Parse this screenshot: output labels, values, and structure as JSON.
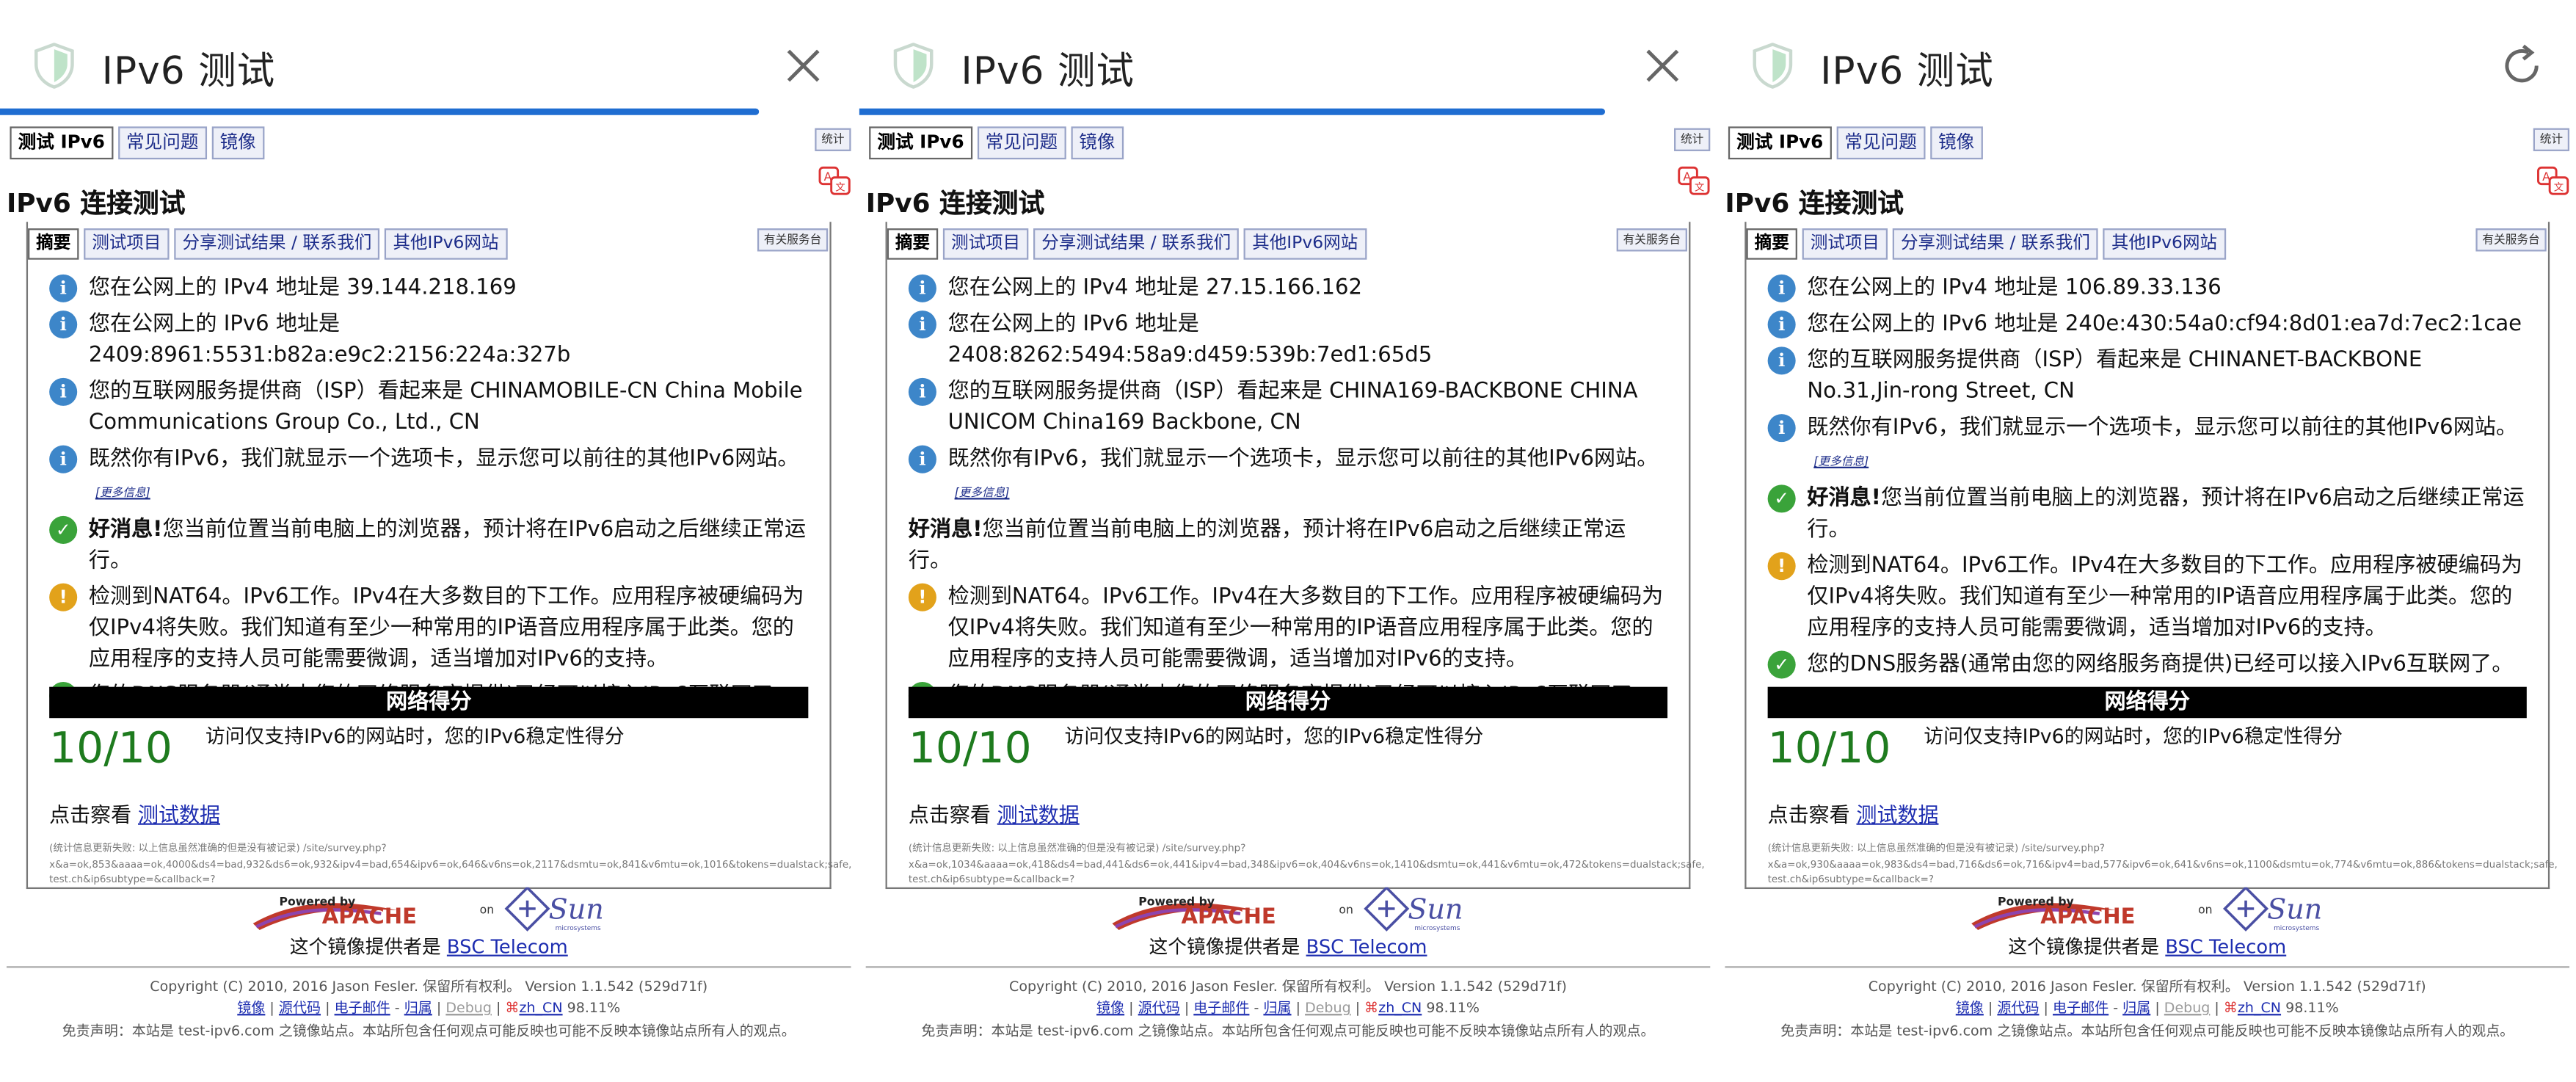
{
  "colors": {
    "progress": "#1f6dd1",
    "score": "#1e7b1e",
    "link": "#1d2db0",
    "tab_bg": "#eef0f8"
  },
  "panels": [
    {
      "title": "IPv6 测试",
      "action_icon": "close-icon",
      "load_progress": 0.885,
      "tabs": [
        "测试 IPv6",
        "常见问题",
        "镜像"
      ],
      "stats": "统计",
      "heading": "IPv6 连接测试",
      "subtabs": [
        "摘要",
        "测试项目",
        "分享测试结果 / 联系我们",
        "其他IPv6网站"
      ],
      "help": "有关服务台",
      "msg_ipv4": "您在公网上的 IPv4 地址是 39.144.218.169",
      "msg_ipv6": "您在公网上的 IPv6 地址是 2409:8961:5531:b82a:e9c2:2156:224a:327b",
      "msg_isp": "您的互联网服务提供商（ISP）看起来是 CHINAMOBILE-CN China Mobile Communications Group Co., Ltd., CN",
      "msg_tab": "既然你有IPv6，我们就显示一个选项卡，显示您可以前往的其他IPv6网站。",
      "more": "[更多信息]",
      "good_label": "好消息!",
      "msg_good": "您当前位置当前电脑上的浏览器，预计将在IPv6启动之后继续正常运行。",
      "msg_nat": "检测到NAT64。IPv6工作。IPv4在大多数目的下工作。应用程序被硬编码为仅IPv4将失败。我们知道有至少一种常用的IP语音应用程序属于此类。您的应用程序的支持人员可能需要微调，适当增加对IPv6的支持。",
      "msg_dns": "您的DNS服务器(通常由您的网络服务商提供)已经可以接入IPv6互联网了。",
      "score_header": "网络得分",
      "score": "10/10",
      "score_desc": "访问仅支持IPv6的网站时，您的IPv6稳定性得分",
      "view_label": "点击察看",
      "view_link": "测试数据",
      "debug1": "(统计信息更新失败: 以上信息虽然准确的但是没有被记录) /site/survey.php?",
      "debug2": "x&a=ok,853&aaaa=ok,4000&ds4=bad,932&ds6=ok,932&ipv4=bad,654&ipv6=ok,646&v6ns=ok,2117&dsmtu=ok,841&v6mtu=ok,1016&tokens=dualstack;safe,",
      "debug3": "test.ch&ip6subtype=&callback=?",
      "provider_label": "这个镜像提供者是",
      "provider_link": "BSC Telecom",
      "copyright": "Copyright (C) 2010, 2016 Jason Fesler. 保留所有权利。 Version 1.1.542 (529d71f)",
      "f_mirror": "镜像",
      "f_source": "源代码",
      "f_email": "电子邮件",
      "f_dash": " - ",
      "f_attr": "归属",
      "f_debug": "Debug",
      "f_lang": "zh_CN",
      "f_pct": "98.11%",
      "disclaimer": "免责声明：本站是 test-ipv6.com 之镜像站点。本站所包含任何观点可能反映也可能不反映本镜像站点所有人的观点。",
      "logo_apache": "APACHE",
      "logo_sun": "Sun",
      "logo_powered": "Powered by",
      "logo_on": "on",
      "logo_micro": "microsystems"
    },
    {
      "title": "IPv6 测试",
      "action_icon": "close-icon",
      "load_progress": 0.87,
      "tabs": [
        "测试 IPv6",
        "常见问题",
        "镜像"
      ],
      "stats": "统计",
      "heading": "IPv6 连接测试",
      "subtabs": [
        "摘要",
        "测试项目",
        "分享测试结果 / 联系我们",
        "其他IPv6网站"
      ],
      "help": "有关服务台",
      "msg_ipv4": "您在公网上的 IPv4 地址是 27.15.166.162",
      "msg_ipv6": "您在公网上的 IPv6 地址是 2408:8262:5494:58a9:d459:539b:7ed1:65d5",
      "msg_isp": "您的互联网服务提供商（ISP）看起来是 CHINA169-BACKBONE CHINA UNICOM China169 Backbone, CN",
      "msg_tab": "既然你有IPv6，我们就显示一个选项卡，显示您可以前往的其他IPv6网站。",
      "more": "[更多信息]",
      "good_label": "好消息!",
      "msg_good": "您当前位置当前电脑上的浏览器，预计将在IPv6启动之后继续正常运行。",
      "msg_nat": "检测到NAT64。IPv6工作。IPv4在大多数目的下工作。应用程序被硬编码为仅IPv4将失败。我们知道有至少一种常用的IP语音应用程序属于此类。您的应用程序的支持人员可能需要微调，适当增加对IPv6的支持。",
      "msg_dns": "您的DNS服务器(通常由您的网络服务商提供)已经可以接入IPv6互联网了。",
      "score_header": "网络得分",
      "score": "10/10",
      "score_desc": "访问仅支持IPv6的网站时，您的IPv6稳定性得分",
      "view_label": "点击察看",
      "view_link": "测试数据",
      "debug1": "(统计信息更新失败: 以上信息虽然准确的但是没有被记录) /site/survey.php?",
      "debug2": "x&a=ok,1034&aaaa=ok,418&ds4=bad,441&ds6=ok,441&ipv4=bad,348&ipv6=ok,404&v6ns=ok,1410&dsmtu=ok,441&v6mtu=ok,472&tokens=dualstack;safe,",
      "debug3": "test.ch&ip6subtype=&callback=?",
      "provider_label": "这个镜像提供者是",
      "provider_link": "BSC Telecom",
      "copyright": "Copyright (C) 2010, 2016 Jason Fesler. 保留所有权利。 Version 1.1.542 (529d71f)",
      "f_mirror": "镜像",
      "f_source": "源代码",
      "f_email": "电子邮件",
      "f_dash": " - ",
      "f_attr": "归属",
      "f_debug": "Debug",
      "f_lang": "zh_CN",
      "f_pct": "98.11%",
      "disclaimer": "免责声明：本站是 test-ipv6.com 之镜像站点。本站所包含任何观点可能反映也可能不反映本镜像站点所有人的观点。",
      "logo_apache": "APACHE",
      "logo_sun": "Sun",
      "logo_powered": "Powered by",
      "logo_on": "on",
      "logo_micro": "microsystems"
    },
    {
      "title": "IPv6 测试",
      "action_icon": "reload-icon",
      "load_progress": 0,
      "tabs": [
        "测试 IPv6",
        "常见问题",
        "镜像"
      ],
      "stats": "统计",
      "heading": "IPv6 连接测试",
      "subtabs": [
        "摘要",
        "测试项目",
        "分享测试结果 / 联系我们",
        "其他IPv6网站"
      ],
      "help": "有关服务台",
      "msg_ipv4": "您在公网上的 IPv4 地址是 106.89.33.136",
      "msg_ipv6": "您在公网上的 IPv6 地址是 240e:430:54a0:cf94:8d01:ea7d:7ec2:1cae",
      "msg_isp": "您的互联网服务提供商（ISP）看起来是 CHINANET-BACKBONE No.31,Jin-rong Street, CN",
      "msg_tab": "既然你有IPv6，我们就显示一个选项卡，显示您可以前往的其他IPv6网站。",
      "more": "[更多信息]",
      "good_label": "好消息!",
      "msg_good": "您当前位置当前电脑上的浏览器，预计将在IPv6启动之后继续正常运行。",
      "msg_nat": "检测到NAT64。IPv6工作。IPv4在大多数目的下工作。应用程序被硬编码为仅IPv4将失败。我们知道有至少一种常用的IP语音应用程序属于此类。您的应用程序的支持人员可能需要微调，适当增加对IPv6的支持。",
      "msg_dns": "您的DNS服务器(通常由您的网络服务商提供)已经可以接入IPv6互联网了。",
      "score_header": "网络得分",
      "score": "10/10",
      "score_desc": "访问仅支持IPv6的网站时，您的IPv6稳定性得分",
      "view_label": "点击察看",
      "view_link": "测试数据",
      "debug1": "(统计信息更新失败: 以上信息虽然准确的但是没有被记录) /site/survey.php?",
      "debug2": "x&a=ok,930&aaaa=ok,983&ds4=bad,716&ds6=ok,716&ipv4=bad,577&ipv6=ok,641&v6ns=ok,1100&dsmtu=ok,774&v6mtu=ok,886&tokens=dualstack;safe,",
      "debug3": "test.ch&ip6subtype=&callback=?",
      "provider_label": "这个镜像提供者是",
      "provider_link": "BSC Telecom",
      "copyright": "Copyright (C) 2010, 2016 Jason Fesler. 保留所有权利。 Version 1.1.542 (529d71f)",
      "f_mirror": "镜像",
      "f_source": "源代码",
      "f_email": "电子邮件",
      "f_dash": " - ",
      "f_attr": "归属",
      "f_debug": "Debug",
      "f_lang": "zh_CN",
      "f_pct": "98.11%",
      "disclaimer": "免责声明：本站是 test-ipv6.com 之镜像站点。本站所包含任何观点可能反映也可能不反映本镜像站点所有人的观点。",
      "logo_apache": "APACHE",
      "logo_sun": "Sun",
      "logo_powered": "Powered by",
      "logo_on": "on",
      "logo_micro": "microsystems"
    }
  ]
}
